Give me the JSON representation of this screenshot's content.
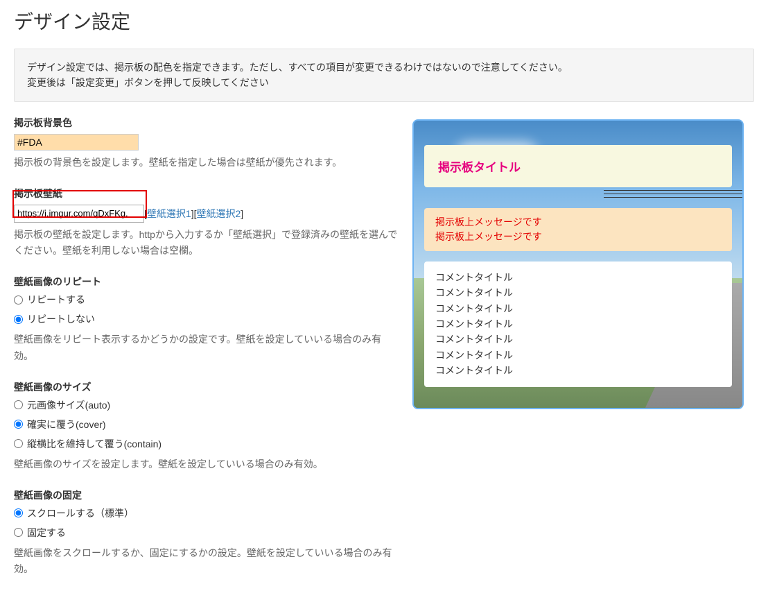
{
  "page": {
    "title": "デザイン設定"
  },
  "info": {
    "line1": "デザイン設定では、掲示板の配色を指定できます。ただし、すべての項目が変更できるわけではないので注意してください。",
    "line2": "変更後は「設定変更」ボタンを押して反映してください"
  },
  "fields": {
    "bg_color": {
      "label": "掲示板背景色",
      "value": "#FDA",
      "help": "掲示板の背景色を設定します。壁紙を指定した場合は壁紙が優先されます。"
    },
    "wallpaper": {
      "label": "掲示板壁紙",
      "value": "https://i.imgur.com/qDxFKg.",
      "link1": "壁紙選択1",
      "link2": "壁紙選択2",
      "help": "掲示板の壁紙を設定します。httpから入力するか「壁紙選択」で登録済みの壁紙を選んでください。壁紙を利用しない場合は空欄。"
    },
    "repeat": {
      "label": "壁紙画像のリピート",
      "opt1": "リピートする",
      "opt2": "リピートしない",
      "selected": "リピートしない",
      "help": "壁紙画像をリピート表示するかどうかの設定です。壁紙を設定していいる場合のみ有効。"
    },
    "size": {
      "label": "壁紙画像のサイズ",
      "opt1": "元画像サイズ(auto)",
      "opt2": "確実に覆う(cover)",
      "opt3": "縦横比を維持して覆う(contain)",
      "selected": "確実に覆う(cover)",
      "help": "壁紙画像のサイズを設定します。壁紙を設定していいる場合のみ有効。"
    },
    "attachment": {
      "label": "壁紙画像の固定",
      "opt1": "スクロールする（標準）",
      "opt2": "固定する",
      "selected": "スクロールする（標準）",
      "help": "壁紙画像をスクロールするか、固定にするかの設定。壁紙を設定していいる場合のみ有効。"
    }
  },
  "preview": {
    "title": "掲示板タイトル",
    "msg1": "掲示板上メッセージです",
    "msg2": "掲示板上メッセージです",
    "comments": [
      "コメントタイトル",
      "コメントタイトル",
      "コメントタイトル",
      "コメントタイトル",
      "コメントタイトル",
      "コメントタイトル",
      "コメントタイトル"
    ]
  }
}
